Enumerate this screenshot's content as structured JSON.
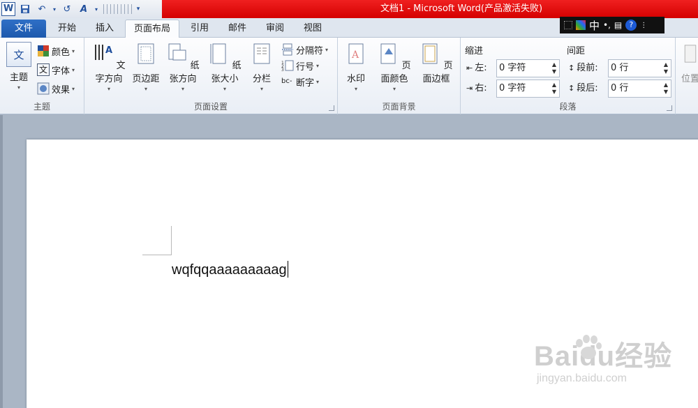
{
  "window": {
    "title": "文档1 - Microsoft Word(产品激活失败)"
  },
  "tabs": [
    "文件",
    "开始",
    "插入",
    "页面布局",
    "引用",
    "邮件",
    "审阅",
    "视图"
  ],
  "ribbon": {
    "theme_group": {
      "label": "主题",
      "themes_btn": "主题",
      "colors_btn": "颜色",
      "fonts_btn": "字体",
      "effects_btn": "效果"
    },
    "page_setup_group": {
      "label": "页面设置",
      "text_direction": "文字方向",
      "margins": "页边距",
      "orientation": "纸张方向",
      "size": "纸张大小",
      "columns": "分栏",
      "breaks": "分隔符",
      "line_numbers": "行号",
      "hyphenation": "断字"
    },
    "page_background_group": {
      "label": "页面背景",
      "watermark": "水印",
      "page_color": "页面颜色",
      "page_borders": "页面边框"
    },
    "paragraph_group": {
      "label": "段落",
      "indent_title": "缩进",
      "indent_left_label": "左:",
      "indent_left_value": "0 字符",
      "indent_right_label": "右:",
      "indent_right_value": "0 字符",
      "spacing_title": "间距",
      "spacing_before_label": "段前:",
      "spacing_before_value": "0 行",
      "spacing_after_label": "段后:",
      "spacing_after_value": "0 行"
    },
    "arrange_group": {
      "position": "位置"
    }
  },
  "ime": {
    "mode": "中"
  },
  "document": {
    "text": "wqfqqaaaaaaaaag"
  },
  "watermark": {
    "brand": "Baidu经验",
    "url": "jingyan.baidu.com"
  },
  "colors": {
    "title_red": "#e00000",
    "file_tab": "#2b63b8",
    "accent": "#2b579a"
  }
}
